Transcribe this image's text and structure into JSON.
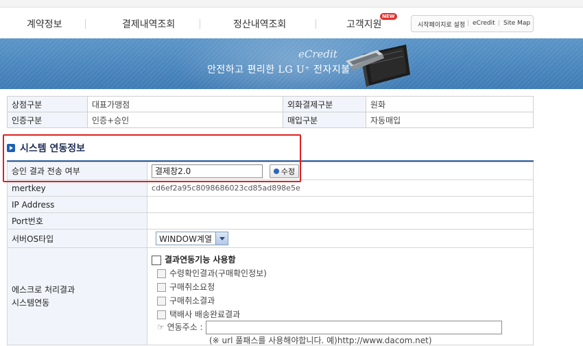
{
  "nav": {
    "items": [
      "계약정보",
      "결제내역조회",
      "정산내역조회",
      "고객지원"
    ],
    "new_badge": "NEW",
    "util": [
      "시작페이지로 설정",
      "eCredit",
      "Site Map"
    ]
  },
  "banner": {
    "brand": "eCredit",
    "tagline": "안전하고 편리한 LG U⁺ 전자지불"
  },
  "store": {
    "rows": [
      {
        "label1": "상점구분",
        "value1": "대표가맹점",
        "label2": "외화결제구분",
        "value2": "원화"
      },
      {
        "label1": "인증구분",
        "value1": "인증+승인",
        "label2": "매입구분",
        "value2": "자동매입"
      }
    ]
  },
  "system": {
    "title": "시스템 연동정보",
    "approval_label": "승인 결과 전송 여부",
    "approval_value": "결제창2.0",
    "modify_button": "수정",
    "mertkey_label": "mertkey",
    "mertkey_value": "cd6ef2a95c8098686023cd85ad898e5e",
    "ip_label": "IP Address",
    "ip_value": "",
    "port_label": "Port번호",
    "port_value": "",
    "os_label": "서버OS타입",
    "os_value": "WINDOW계열",
    "escrow_label_1": "에스크로 처리결과",
    "escrow_label_2": "시스템연동",
    "escrow_main": "결과연동기능 사용함",
    "escrow_options": [
      "수령확인결과(구매확인정보)",
      "구매취소요청",
      "구매취소결과",
      "택배사 배송완료결과"
    ],
    "url_label": "☞ 연동주소 :",
    "url_value": "",
    "url_note": "(※ url 풀패스를 사용해야합니다. 예)http://www.dacom.net)"
  },
  "colors": {
    "highlight": "#e01f1f",
    "label_bg": "#f1f5fb",
    "accent": "#1b61b5"
  }
}
